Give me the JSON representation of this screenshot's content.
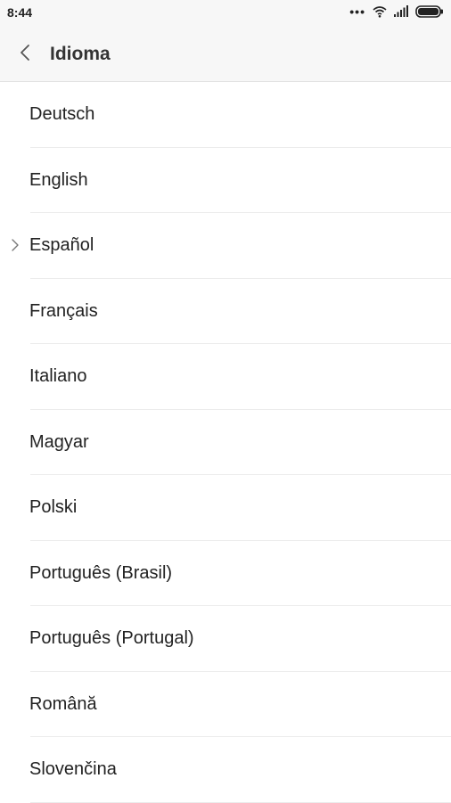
{
  "status_bar": {
    "time": "8:44",
    "icons": [
      "more-dots-icon",
      "wifi-icon",
      "signal-icon",
      "battery-icon"
    ]
  },
  "header": {
    "title": "Idioma",
    "back_icon": "chevron-left-icon"
  },
  "languages": [
    {
      "label": "Deutsch",
      "selected": false
    },
    {
      "label": "English",
      "selected": false
    },
    {
      "label": "Español",
      "selected": true
    },
    {
      "label": "Français",
      "selected": false
    },
    {
      "label": "Italiano",
      "selected": false
    },
    {
      "label": "Magyar",
      "selected": false
    },
    {
      "label": "Polski",
      "selected": false
    },
    {
      "label": "Português (Brasil)",
      "selected": false
    },
    {
      "label": "Português (Portugal)",
      "selected": false
    },
    {
      "label": "Română",
      "selected": false
    },
    {
      "label": "Slovenčina",
      "selected": false
    }
  ],
  "colors": {
    "header_bg": "#f7f7f7",
    "text": "#222222",
    "divider": "#ececec"
  }
}
